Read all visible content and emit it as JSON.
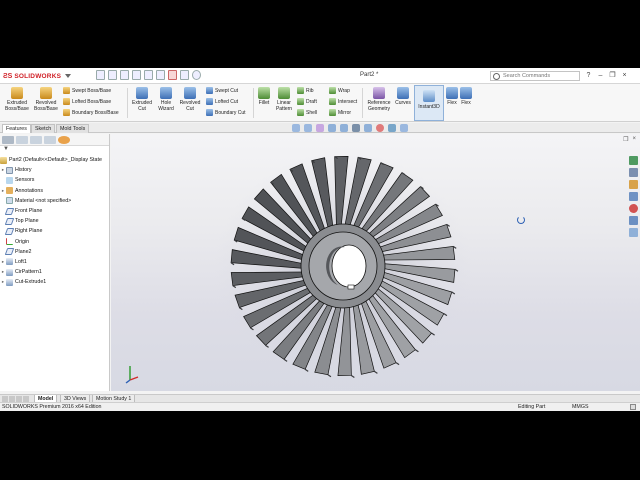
{
  "app": {
    "brand": "SOLIDWORKS",
    "document_title": "Part2 *"
  },
  "search": {
    "placeholder": "Search Commands"
  },
  "ribbon": {
    "extruded_boss": "Extruded Boss/Base",
    "revolved_boss": "Revolved Boss/Base",
    "swept_boss": "Swept Boss/Base",
    "lofted_boss": "Lofted Boss/Base",
    "boundary_boss": "Boundary Boss/Base",
    "extruded_cut": "Extruded Cut",
    "hole_wizard": "Hole Wizard",
    "revolved_cut": "Revolved Cut",
    "swept_cut": "Swept Cut",
    "lofted_cut": "Lofted Cut",
    "boundary_cut": "Boundary Cut",
    "fillet": "Fillet",
    "linear_pattern": "Linear Pattern",
    "rib": "Rib",
    "draft": "Draft",
    "shell": "Shell",
    "wrap": "Wrap",
    "intersect": "Intersect",
    "mirror": "Mirror",
    "reference_geometry": "Reference Geometry",
    "curves": "Curves",
    "instant3d": "Instant3D",
    "flex1": "Flex",
    "flex2": "Flex"
  },
  "command_tabs": [
    "Features",
    "Sketch",
    "Mold Tools"
  ],
  "feature_tree": {
    "root": "Part2  (Default<<Default>_Display State",
    "items": [
      "History",
      "Sensors",
      "Annotations",
      "Material <not specified>",
      "Front Plane",
      "Top Plane",
      "Right Plane",
      "Origin",
      "Plane2",
      "Loft1",
      "CirPattern1",
      "Cut-Extrude1"
    ]
  },
  "bottom_tabs": [
    "Model",
    "3D Views",
    "Motion Study 1"
  ],
  "status": {
    "edition": "SOLIDWORKS Premium 2016 x64 Edition",
    "mode": "Editing Part",
    "units": "MMGS"
  },
  "colors": {
    "brand_red": "#d02027",
    "viewport_top": "#f4f4f6",
    "viewport_bottom": "#d7d9e3",
    "part_face": "#8d8f93",
    "part_edge": "#111111",
    "accent_blue": "#2f62b5"
  },
  "icons": {
    "search": "search-icon",
    "help": "help-icon",
    "user": "user-icon",
    "rotate": "rotate-cursor-icon"
  }
}
